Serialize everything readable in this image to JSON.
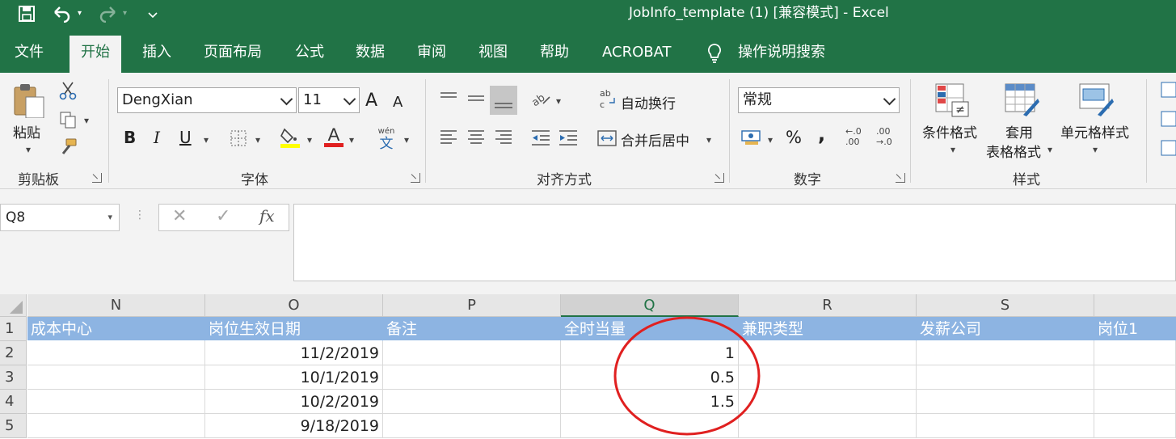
{
  "window": {
    "title": "JobInfo_template (1)  [兼容模式]  -  Excel",
    "accent": "#217346"
  },
  "quick_access": {
    "save_icon": "save-icon",
    "undo_icon": "undo-icon",
    "redo_icon": "redo-icon",
    "customize_icon": "customize-quick-access-icon"
  },
  "tabs": [
    {
      "label": "文件"
    },
    {
      "label": "开始",
      "active": true
    },
    {
      "label": "插入"
    },
    {
      "label": "页面布局"
    },
    {
      "label": "公式"
    },
    {
      "label": "数据"
    },
    {
      "label": "审阅"
    },
    {
      "label": "视图"
    },
    {
      "label": "帮助"
    },
    {
      "label": "ACROBAT"
    }
  ],
  "tell_me": {
    "label": "操作说明搜索",
    "icon": "lightbulb-icon"
  },
  "ribbon": {
    "clipboard": {
      "label": "剪贴板",
      "paste": "粘贴",
      "icons": [
        "paste-icon",
        "cut-icon",
        "copy-icon",
        "format-painter-icon"
      ]
    },
    "font": {
      "label": "字体",
      "font_name": "DengXian",
      "font_size": "11",
      "increase": "A",
      "decrease": "A",
      "bold": "B",
      "italic": "I",
      "underline": "U",
      "font_color_letter": "A",
      "phonetic_top": "wén",
      "phonetic_bottom": "文",
      "icons": [
        "borders-icon",
        "fill-color-icon",
        "font-color-icon",
        "phonetic-guide-icon"
      ]
    },
    "alignment": {
      "label": "对齐方式",
      "wrap_text": "自动换行",
      "merge_center": "合并后居中",
      "wrap_glyph_top": "ab",
      "wrap_glyph_bottom": "c"
    },
    "number": {
      "label": "数字",
      "format": "常规",
      "percent": "%",
      "comma": ",",
      "inc_decimal_top": "←.0",
      "inc_decimal_bottom": ".00",
      "dec_decimal_top": ".00",
      "dec_decimal_bottom": "→.0"
    },
    "styles": {
      "label": "样式",
      "conditional": "条件格式",
      "table_line1": "套用",
      "table_line2": "表格格式",
      "cell_styles": "单元格样式"
    }
  },
  "formula_bar": {
    "name_box": "Q8",
    "cancel": "✕",
    "enter": "✓",
    "fx": "fx",
    "content": ""
  },
  "sheet": {
    "columns": [
      "N",
      "O",
      "P",
      "Q",
      "R",
      "S"
    ],
    "selected_column": "Q",
    "rows": [
      "1",
      "2",
      "3",
      "4",
      "5"
    ],
    "header_row": [
      "成本中心",
      "岗位生效日期",
      "备注",
      "全时当量",
      "兼职类型",
      "发薪公司",
      "岗位1"
    ],
    "data": [
      [
        "",
        "11/2/2019",
        "",
        "1",
        "",
        "",
        ""
      ],
      [
        "",
        "10/1/2019",
        "",
        "0.5",
        "",
        "",
        ""
      ],
      [
        "",
        "10/2/2019",
        "",
        "1.5",
        "",
        "",
        ""
      ],
      [
        "",
        "9/18/2019",
        "",
        "",
        "",
        "",
        ""
      ]
    ],
    "header_fill": "#8db4e2",
    "annotation_color": "#e02020"
  }
}
